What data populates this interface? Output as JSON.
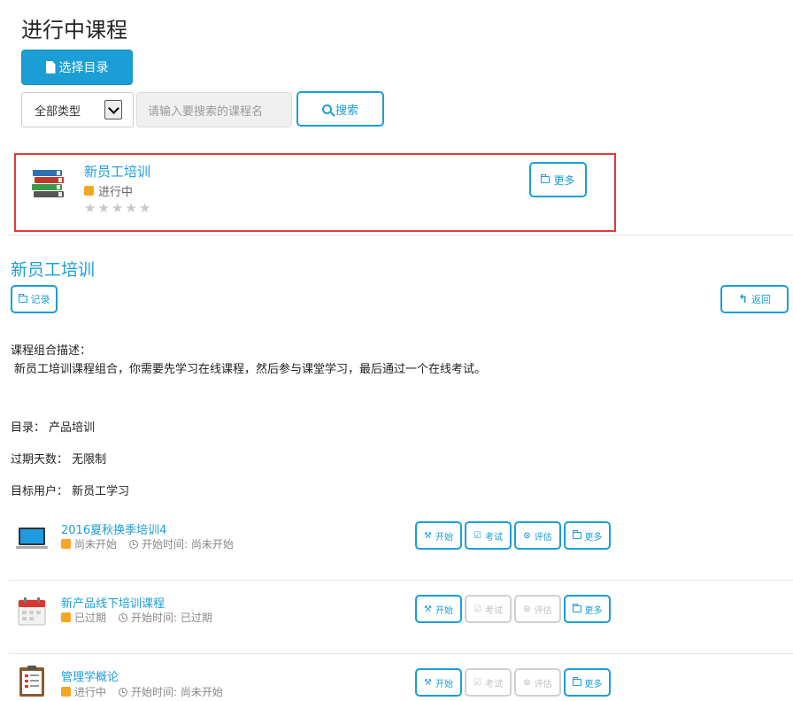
{
  "header": {
    "title": "进行中课程",
    "select_catalog_label": "选择目录"
  },
  "filters": {
    "type_selected": "全部类型",
    "search_placeholder": "请输入要搜索的课程名",
    "search_label": "搜索"
  },
  "card": {
    "name": "新员工培训",
    "status": "进行中",
    "rating": 0,
    "rating_max": 5,
    "more_label": "更多"
  },
  "detail": {
    "title": "新员工培训",
    "record_label": "记录",
    "back_label": "返回",
    "desc_label": "课程组合描述：",
    "desc_text": "新员工培训课程组合，你需要先学习在线课程，然后参与课堂学习，最后通过一个在线考试。",
    "catalog_label": "目录：",
    "catalog_value": "产品培训",
    "expiry_label": "过期天数：",
    "expiry_value": "无限制",
    "target_label": "目标用户：",
    "target_value": "新员工学习"
  },
  "courses": [
    {
      "name": "2016夏秋换季培训4",
      "status": "尚未开始",
      "start_time": "开始时间: 尚未开始",
      "icon": "laptop-icon",
      "actions": [
        {
          "label": "开始",
          "enabled": true
        },
        {
          "label": "考试",
          "enabled": true
        },
        {
          "label": "评估",
          "enabled": true
        },
        {
          "label": "更多",
          "enabled": true
        }
      ]
    },
    {
      "name": "新产品线下培训课程",
      "status": "已过期",
      "start_time": "开始时间: 已过期",
      "icon": "calendar-icon",
      "actions": [
        {
          "label": "开始",
          "enabled": true
        },
        {
          "label": "考试",
          "enabled": false
        },
        {
          "label": "评估",
          "enabled": false
        },
        {
          "label": "更多",
          "enabled": true
        }
      ]
    },
    {
      "name": "管理学概论",
      "status": "进行中",
      "start_time": "开始时间: 尚未开始",
      "icon": "clipboard-icon",
      "actions": [
        {
          "label": "开始",
          "enabled": true
        },
        {
          "label": "考试",
          "enabled": false
        },
        {
          "label": "评估",
          "enabled": false
        },
        {
          "label": "更多",
          "enabled": true
        }
      ]
    }
  ],
  "colors": {
    "accent": "#1b9ed6",
    "status_orange": "#f5a623",
    "highlight_border": "#e23a3a"
  }
}
